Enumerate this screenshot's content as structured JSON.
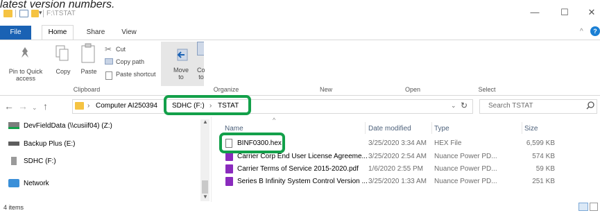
{
  "caption": {
    "text": "latest version numbers."
  },
  "window": {
    "title": "F:\\TSTAT",
    "controls": {
      "minimize": "—",
      "maximize": "☐",
      "close": "✕"
    }
  },
  "ribbon": {
    "tabs": [
      "File",
      "Home",
      "Share",
      "View"
    ],
    "clipboard": {
      "pin_to_quick": "Pin to Quick access",
      "copy": "Copy",
      "paste": "Paste",
      "cut": "Cut",
      "copy_path": "Copy path",
      "paste_shortcut": "Paste shortcut",
      "group_label": "Clipboard"
    },
    "organize": {
      "move_to": "Move to",
      "copy_to": "Cop to",
      "group_label": "Organize"
    },
    "new_label": "New",
    "open_label": "Open",
    "select_label": "Select"
  },
  "address_bar": {
    "crumbs": [
      "Computer AI250394",
      "SDHC (F:)",
      "TSTAT"
    ],
    "search_placeholder": "Search TSTAT"
  },
  "nav_pane": {
    "items": [
      "DevFieldData (\\\\cusiif04) (Z:)",
      "Backup Plus (E:)",
      "SDHC (F:)",
      "Network"
    ]
  },
  "file_list": {
    "headers": {
      "name": "Name",
      "date": "Date modified",
      "type": "Type",
      "size": "Size"
    },
    "rows": [
      {
        "name": "BINF0300.hex",
        "date": "3/25/2020 3:34 AM",
        "type": "HEX File",
        "size": "6,599 KB",
        "icon": "document-icon"
      },
      {
        "name": "Carrier Corp End User License Agreeme...",
        "date": "3/25/2020 2:54 AM",
        "type": "Nuance Power PD...",
        "size": "574 KB",
        "icon": "pdf-icon"
      },
      {
        "name": "Carrier Terms of Service 2015-2020.pdf",
        "date": "1/6/2020 2:55 PM",
        "type": "Nuance Power PD...",
        "size": "59 KB",
        "icon": "pdf-icon"
      },
      {
        "name": "Series B Infinity System Control Version ...",
        "date": "3/25/2020 1:33 AM",
        "type": "Nuance Power PD...",
        "size": "251 KB",
        "icon": "pdf-icon"
      }
    ]
  },
  "status": {
    "items_count": "4 items"
  },
  "colors": {
    "highlight": "#13a04a",
    "file_tab": "#1a62b4",
    "folder": "#f5c342",
    "pdf": "#8a2bbd"
  }
}
